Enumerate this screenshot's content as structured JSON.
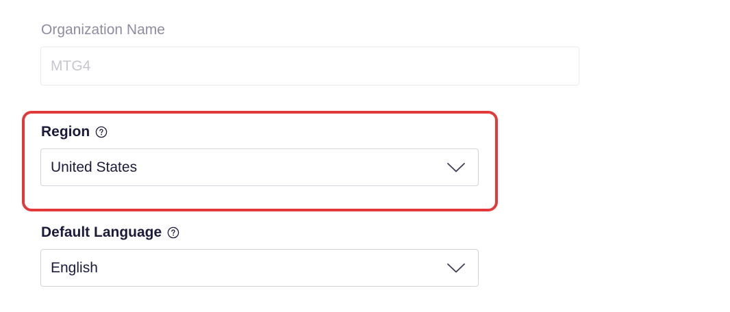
{
  "organization": {
    "label": "Organization Name",
    "value": "MTG4"
  },
  "region": {
    "label": "Region",
    "selected": "United States"
  },
  "language": {
    "label": "Default Language",
    "selected": "English"
  },
  "icons": {
    "help": "question-circle-icon",
    "chevron": "chevron-down-icon"
  },
  "colors": {
    "highlight": "#e23a3a",
    "label_active": "#1b1a3a",
    "label_disabled": "#8e8ca1"
  }
}
